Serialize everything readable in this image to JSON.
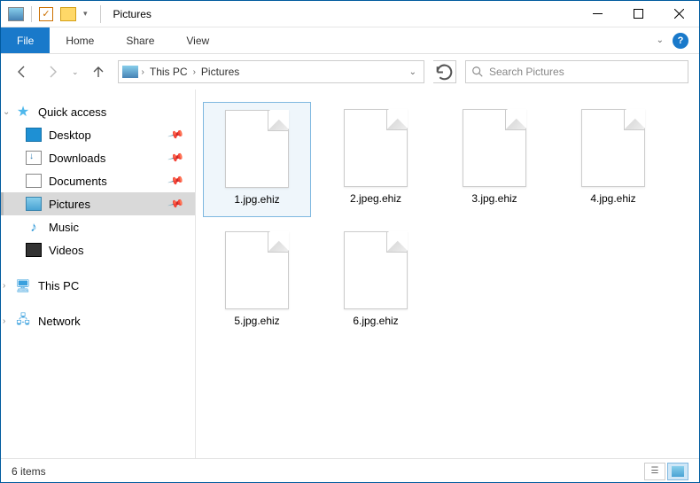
{
  "window": {
    "title": "Pictures"
  },
  "ribbon": {
    "file": "File",
    "tabs": [
      "Home",
      "Share",
      "View"
    ]
  },
  "breadcrumbs": [
    "This PC",
    "Pictures"
  ],
  "search": {
    "placeholder": "Search Pictures"
  },
  "nav": {
    "quick_access": "Quick access",
    "items": [
      {
        "label": "Desktop",
        "pinned": true
      },
      {
        "label": "Downloads",
        "pinned": true
      },
      {
        "label": "Documents",
        "pinned": true
      },
      {
        "label": "Pictures",
        "pinned": true,
        "selected": true
      },
      {
        "label": "Music",
        "pinned": false
      },
      {
        "label": "Videos",
        "pinned": false
      }
    ],
    "this_pc": "This PC",
    "network": "Network"
  },
  "files": [
    {
      "name": "1.jpg.ehiz",
      "selected": true
    },
    {
      "name": "2.jpeg.ehiz"
    },
    {
      "name": "3.jpg.ehiz"
    },
    {
      "name": "4.jpg.ehiz"
    },
    {
      "name": "5.jpg.ehiz"
    },
    {
      "name": "6.jpg.ehiz"
    }
  ],
  "status": {
    "text": "6 items"
  }
}
